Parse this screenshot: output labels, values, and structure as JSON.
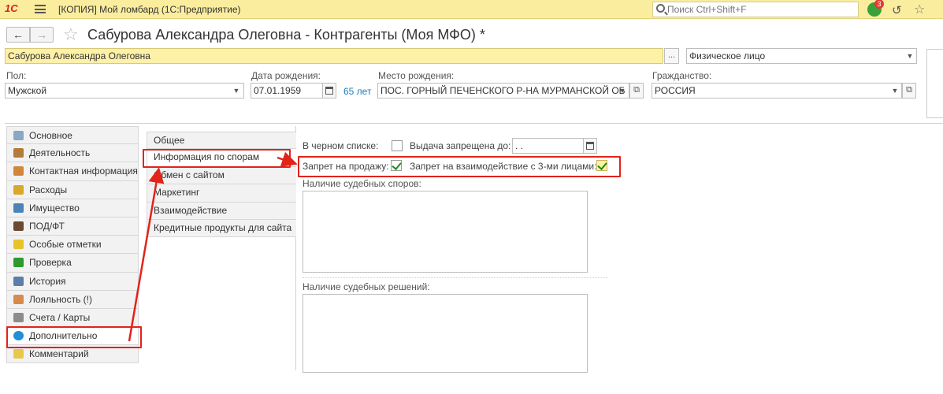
{
  "app": {
    "logo": "1С",
    "title": "[КОПИЯ] Мой ломбард  (1С:Предприятие)",
    "search_placeholder": "Поиск Ctrl+Shift+F",
    "notifications_count": "3"
  },
  "form": {
    "title": "Сабурова Александра Олеговна - Контрагенты (Моя МФО) *",
    "name_value": "Сабурова Александра Олеговна",
    "select_button": "...",
    "person_type": "Физическое лицо",
    "gender_label": "Пол:",
    "gender_value": "Мужской",
    "birthdate_label": "Дата рождения:",
    "birthdate_value": "07.01.1959",
    "age": "65 лет",
    "birthplace_label": "Место рождения:",
    "birthplace_value": "ПОС. ГОРНЫЙ ПЕЧЕНСКОГО Р-НА МУРМАНСКОЙ ОБ",
    "citizenship_label": "Гражданство:",
    "citizenship_value": "РОССИЯ"
  },
  "left_nav": [
    {
      "label": "Основное",
      "icon": "main-icon",
      "color": "#8aa7c6"
    },
    {
      "label": "Деятельность",
      "icon": "briefcase-icon",
      "color": "#b57a3a"
    },
    {
      "label": "Контактная информация",
      "icon": "contacts-icon",
      "color": "#d2863a"
    },
    {
      "label": "Расходы",
      "icon": "coins-icon",
      "color": "#d9a72a"
    },
    {
      "label": "Имущество",
      "icon": "car-icon",
      "color": "#4f83b8"
    },
    {
      "label": "ПОД/ФТ",
      "icon": "person-icon",
      "color": "#6b4a33"
    },
    {
      "label": "Особые отметки",
      "icon": "exclamation-icon",
      "color": "#e8c22a"
    },
    {
      "label": "Проверка",
      "icon": "check-icon",
      "color": "#2e9a2e"
    },
    {
      "label": "История",
      "icon": "clock-icon",
      "color": "#5b7fa8"
    },
    {
      "label": "Лояльность (!)",
      "icon": "gift-icon",
      "color": "#d88a4a"
    },
    {
      "label": "Счета / Карты",
      "icon": "bank-icon",
      "color": "#8c8c8c"
    },
    {
      "label": "Дополнительно",
      "icon": "gear-icon",
      "color": "#1f8fd6"
    },
    {
      "label": "Комментарий",
      "icon": "comment-icon",
      "color": "#e8c84a"
    }
  ],
  "active_nav_index": 11,
  "sub_tabs": [
    "Общее",
    "Информация по спорам",
    "Обмен с сайтом",
    "Маркетинг",
    "Взаимодействие",
    "Кредитные продукты для сайта"
  ],
  "active_sub_tab_index": 1,
  "content": {
    "blacklist_label": "В черном списке:",
    "issue_ban_label": "Выдача запрещена до:",
    "issue_ban_value": " .  .",
    "sale_ban_label": "Запрет на продажу:",
    "third_party_ban_label": "Запрет на взаимодействие с 3-ми лицами:",
    "court_disputes_label": "Наличие судебных споров:",
    "court_decisions_label": "Наличие судебных решений:"
  },
  "colors": {
    "appbar": "#fbed9e",
    "highlight": "#e2231a",
    "link": "#1a7fb8",
    "check": "#1e8a1e"
  }
}
